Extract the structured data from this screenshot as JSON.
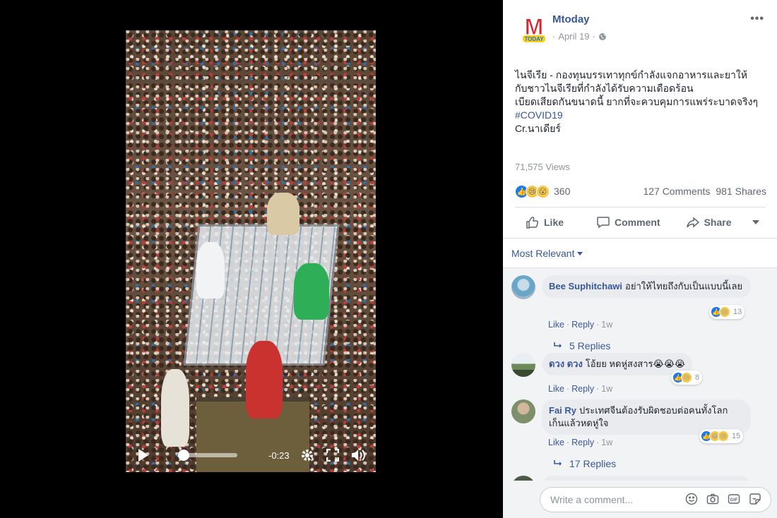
{
  "video": {
    "time_remaining": "-0:23",
    "progress_percent": 12
  },
  "post": {
    "page_name": "Mtoday",
    "logo_letter": "M",
    "logo_sub": "TODAY",
    "date": "April 19",
    "date_sep": "·",
    "text_lines": [
      "ไนจีเรีย - กองทุนบรรเทาทุกข์กำลังแจกอาหารและยาให้",
      "กับชาวไนจีเรียที่กำลังได้รับความเดือดร้อน",
      "เบียดเสียดกันขนาดนี้ ยากที่จะควบคุมการแพร่ระบาดจริงๆ"
    ],
    "hashtag": "#COVID19",
    "credit": "Cr.นาเดียร์",
    "views": "71,575 Views",
    "reaction_count": "360",
    "comments": "127 Comments",
    "shares": "981 Shares"
  },
  "actions": {
    "like": "Like",
    "comment": "Comment",
    "share": "Share"
  },
  "sort": {
    "label": "Most Relevant"
  },
  "comments": [
    {
      "author": "Bee Suphitchawi",
      "text": "อย่าให้ไทยถึงกับเป็นแบบนี้เลย",
      "like": "Like",
      "reply": "Reply",
      "age": "1w",
      "reaction_count": "13",
      "replies": "5 Replies"
    },
    {
      "author": "ดวง ดวง",
      "text": "โอ้ยย หดหู่สงสาร",
      "like": "Like",
      "reply": "Reply",
      "age": "1w",
      "reaction_count": "8"
    },
    {
      "author": "Fai Ry",
      "text_line1": "ประเทศจีนต้องรับผิดชอบต่อคนทั้งโลก",
      "text_line2": "เก็นแล้วหดหู่ใจ",
      "like": "Like",
      "reply": "Reply",
      "age": "1w",
      "reaction_count": "15",
      "replies": "17 Replies"
    }
  ],
  "composer": {
    "placeholder": "Write a comment..."
  },
  "colors": {
    "link": "#365899",
    "muted": "#90949c",
    "accent_blue": "#4a8ff0"
  }
}
